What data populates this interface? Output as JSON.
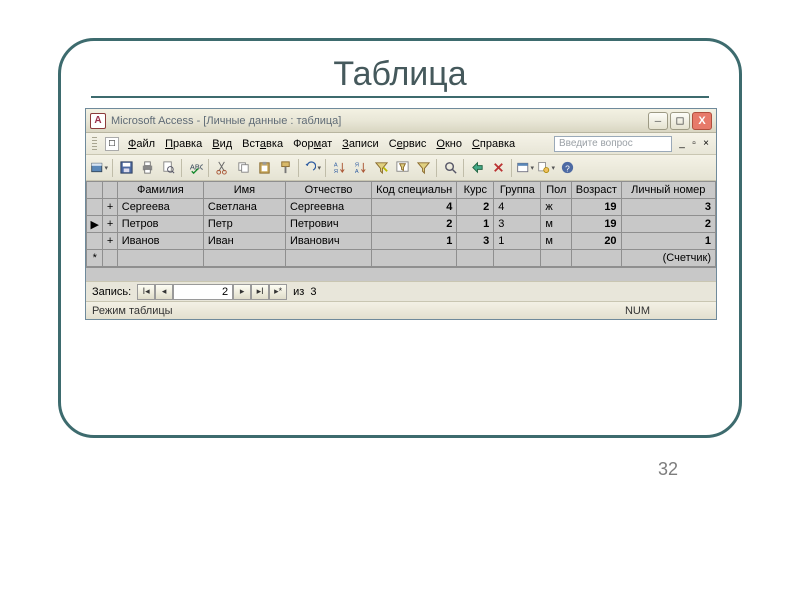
{
  "slide": {
    "title": "Таблица",
    "page_number": "32"
  },
  "window": {
    "title": "Microsoft Access - [Личные данные : таблица]"
  },
  "menu": {
    "items": [
      {
        "label": "Файл",
        "u": "Ф"
      },
      {
        "label": "Правка",
        "u": "П"
      },
      {
        "label": "Вид",
        "u": "В"
      },
      {
        "label": "Вставка",
        "u": ""
      },
      {
        "label": "Формат",
        "u": ""
      },
      {
        "label": "Записи",
        "u": "З"
      },
      {
        "label": "Сервис",
        "u": "С"
      },
      {
        "label": "Окно",
        "u": "О"
      },
      {
        "label": "Справка",
        "u": "С"
      }
    ],
    "question_placeholder": "Введите вопрос"
  },
  "toolbar_icons": [
    "view-icon",
    "save-icon",
    "print-icon",
    "print-preview-icon",
    "spellcheck-icon",
    "cut-icon",
    "copy-icon",
    "paste-icon",
    "format-painter-icon",
    "undo-icon",
    "sort-asc-icon",
    "sort-desc-icon",
    "filter-selection-icon",
    "filter-form-icon",
    "apply-filter-icon",
    "find-icon",
    "new-record-icon",
    "delete-record-icon",
    "datasheet-icon",
    "properties-icon",
    "help-icon"
  ],
  "grid": {
    "columns": [
      "Фамилия",
      "Имя",
      "Отчество",
      "Код специальн",
      "Курс",
      "Группа",
      "Пол",
      "Возраст",
      "Личный номер"
    ],
    "rows": [
      {
        "marker": "",
        "exp": "+",
        "c": [
          "Сергеева",
          "Светлана",
          "Сергеевна",
          "4",
          "2",
          "4",
          "ж",
          "19",
          "3"
        ]
      },
      {
        "marker": "▶",
        "exp": "+",
        "c": [
          "Петров",
          "Петр",
          "Петрович",
          "2",
          "1",
          "3",
          "м",
          "19",
          "2"
        ]
      },
      {
        "marker": "",
        "exp": "+",
        "c": [
          "Иванов",
          "Иван",
          "Иванович",
          "1",
          "3",
          "1",
          "м",
          "20",
          "1"
        ]
      }
    ],
    "new_row_marker": "*",
    "autonumber_label": "(Счетчик)"
  },
  "recordnav": {
    "label": "Запись:",
    "current": "2",
    "of_label": "из",
    "total": "3"
  },
  "status": {
    "mode": "Режим таблицы",
    "num": "NUM"
  }
}
